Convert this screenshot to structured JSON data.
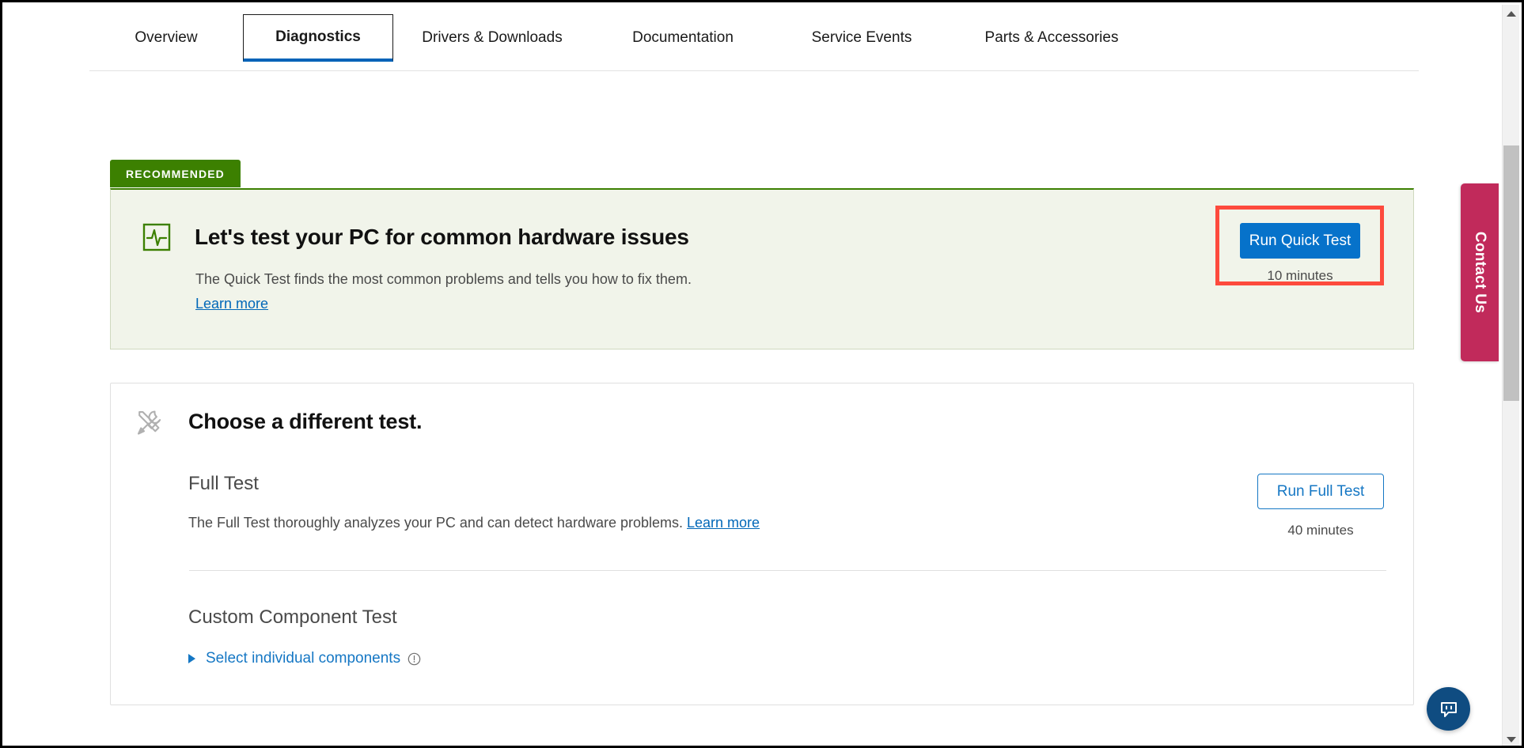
{
  "tabs": [
    {
      "label": "Overview",
      "active": false
    },
    {
      "label": "Diagnostics",
      "active": true
    },
    {
      "label": "Drivers & Downloads",
      "active": false
    },
    {
      "label": "Documentation",
      "active": false
    },
    {
      "label": "Service Events",
      "active": false
    },
    {
      "label": "Parts & Accessories",
      "active": false
    }
  ],
  "recommended": {
    "badge": "RECOMMENDED",
    "icon": "pulse-monitor-icon",
    "title": "Let's test your PC for common hardware issues",
    "description": "The Quick Test finds the most common problems and tells you how to fix them.",
    "learn_more": "Learn more",
    "run_button": "Run Quick Test",
    "duration": "10 minutes",
    "accent_color": "#3c8001",
    "button_color": "#0672ca",
    "highlight_color": "#fd4a3d",
    "background_color": "#f1f4ea"
  },
  "choose": {
    "icon": "tools-icon",
    "title": "Choose a different test.",
    "full_test": {
      "name": "Full Test",
      "description": "The Full Test thoroughly analyzes your PC and can detect hardware problems.",
      "learn_more": "Learn more",
      "run_button": "Run Full Test",
      "duration": "40 minutes"
    },
    "custom_test": {
      "name": "Custom Component Test",
      "select_label": "Select individual components",
      "info_icon": "alert-circle-icon"
    }
  },
  "contact": {
    "label": "Contact Us",
    "color": "#c12a5b"
  },
  "chat": {
    "icon": "chat-bubble-icon",
    "color": "#0f4c81"
  },
  "scrollbar": {
    "up_icon": "scroll-up-arrow-icon",
    "down_icon": "scroll-down-arrow-icon"
  }
}
